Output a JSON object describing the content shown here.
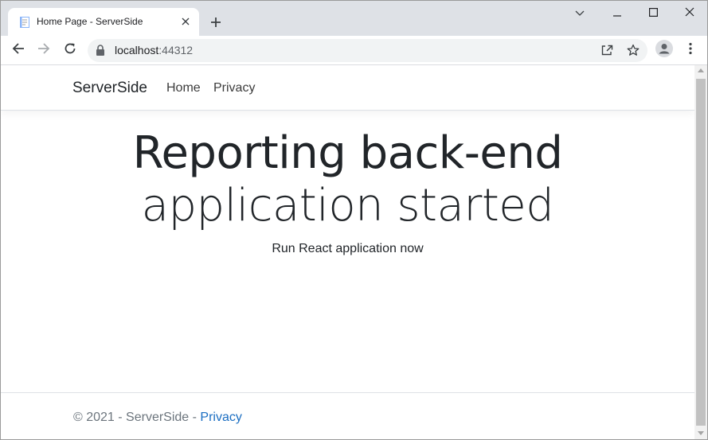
{
  "browser": {
    "tab": {
      "title": "Home Page - ServerSide",
      "favicon": "document-icon"
    },
    "new_tab_label": "+",
    "address": {
      "host": "localhost",
      "port": ":44312"
    },
    "window_controls": [
      "chevron-down-icon",
      "minimize-icon",
      "maximize-icon",
      "close-icon"
    ]
  },
  "page": {
    "navbar": {
      "brand": "ServerSide",
      "links": [
        "Home",
        "Privacy"
      ]
    },
    "hero": {
      "line1": "Reporting back-end",
      "line2": "application started",
      "lead": "Run React application now"
    },
    "footer": {
      "prefix": "© 2021 - ServerSide - ",
      "link": "Privacy"
    }
  },
  "colors": {
    "link": "#1b6ec2",
    "muted": "#6c757d",
    "tabstrip": "#dee1e6"
  }
}
